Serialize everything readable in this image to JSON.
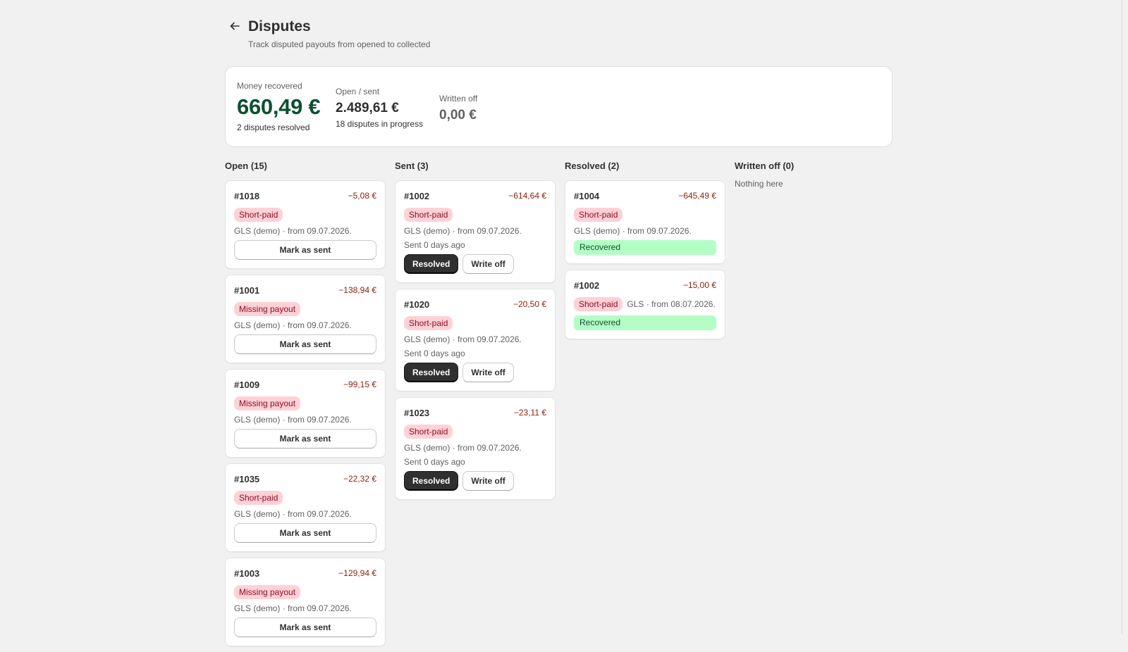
{
  "header": {
    "title": "Disputes",
    "subtitle": "Track disputed payouts from opened to collected"
  },
  "summary": {
    "recovered_label": "Money recovered",
    "recovered_value": "660,49 €",
    "recovered_sub": "2 disputes resolved",
    "open_label": "Open / sent",
    "open_value": "2.489,61 €",
    "open_sub": "18 disputes in progress",
    "written_label": "Written off",
    "written_value": "0,00 €"
  },
  "columns": {
    "open": {
      "title": "Open (15)",
      "cards": [
        {
          "id": "#1018",
          "amount": "−5,08 €",
          "badge": "Short-paid",
          "meta": "GLS (demo) · from 09.07.2026.",
          "action": "Mark as sent"
        },
        {
          "id": "#1001",
          "amount": "−138,94 €",
          "badge": "Missing payout",
          "meta": "GLS (demo) · from 09.07.2026.",
          "action": "Mark as sent"
        },
        {
          "id": "#1009",
          "amount": "−99,15 €",
          "badge": "Missing payout",
          "meta": "GLS (demo) · from 09.07.2026.",
          "action": "Mark as sent"
        },
        {
          "id": "#1035",
          "amount": "−22,32 €",
          "badge": "Short-paid",
          "meta": "GLS (demo) · from 09.07.2026.",
          "action": "Mark as sent"
        },
        {
          "id": "#1003",
          "amount": "−129,94 €",
          "badge": "Missing payout",
          "meta": "GLS (demo) · from 09.07.2026.",
          "action": "Mark as sent"
        }
      ]
    },
    "sent": {
      "title": "Sent (3)",
      "cards": [
        {
          "id": "#1002",
          "amount": "−614,64 €",
          "badge": "Short-paid",
          "meta": "GLS (demo) · from 09.07.2026.",
          "sent": "Sent 0 days ago",
          "resolve": "Resolved",
          "writeoff": "Write off"
        },
        {
          "id": "#1020",
          "amount": "−20,50 €",
          "badge": "Short-paid",
          "meta": "GLS (demo) · from 09.07.2026.",
          "sent": "Sent 0 days ago",
          "resolve": "Resolved",
          "writeoff": "Write off"
        },
        {
          "id": "#1023",
          "amount": "−23,11 €",
          "badge": "Short-paid",
          "meta": "GLS (demo) · from 09.07.2026.",
          "sent": "Sent 0 days ago",
          "resolve": "Resolved",
          "writeoff": "Write off"
        }
      ]
    },
    "resolved": {
      "title": "Resolved (2)",
      "cards": [
        {
          "id": "#1004",
          "amount": "−645,49 €",
          "badge": "Short-paid",
          "meta": "GLS (demo) · from 09.07.2026.",
          "status": "Recovered"
        },
        {
          "id": "#1002",
          "amount": "−15,00 €",
          "badge": "Short-paid",
          "meta": "GLS · from 08.07.2026.",
          "status": "Recovered"
        }
      ]
    },
    "written_off": {
      "title": "Written off (0)",
      "empty": "Nothing here"
    }
  }
}
